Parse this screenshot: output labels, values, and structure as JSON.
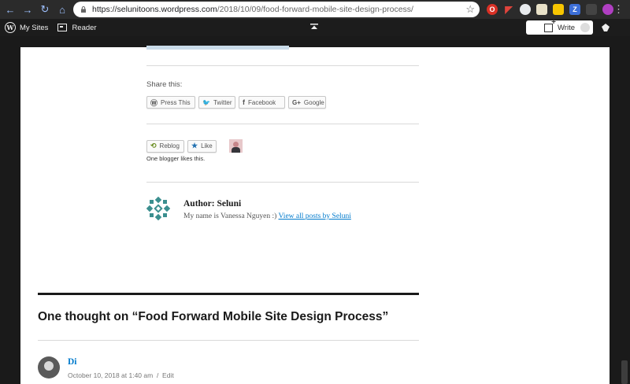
{
  "browser": {
    "url_host": "https://selunitoons.wordpress.com",
    "url_path": "/2018/10/09/food-forward-mobile-site-design-process/",
    "extension_label_z": "Z"
  },
  "admin_bar": {
    "my_sites_label": "My Sites",
    "reader_label": "Reader",
    "write_label": "Write"
  },
  "post": {
    "share_title": "Share this:",
    "share_buttons": [
      {
        "icon": "press-this-icon",
        "glyph": "Ⓦ",
        "label": "Press This"
      },
      {
        "icon": "twitter-icon",
        "glyph": "🐦",
        "label": "Twitter"
      },
      {
        "icon": "facebook-icon",
        "glyph": "f",
        "label": "Facebook"
      },
      {
        "icon": "google-icon",
        "glyph": "G+",
        "label": "Google"
      }
    ],
    "reblog_label": "Reblog",
    "like_label": "Like",
    "likes_text": "One blogger likes this.",
    "author_heading": "Author: Seluni",
    "author_bio": "My name is Vanessa Nguyen :)",
    "author_link": "View all posts by Seluni"
  },
  "comments": {
    "title": "One thought on “Food Forward Mobile Site Design Process”",
    "items": [
      {
        "name": "Di",
        "date": "October 10, 2018 at 1:40 am",
        "edit": "Edit"
      }
    ]
  },
  "colors": {
    "link": "#007acc",
    "admin_bar": "#1c1c1c",
    "chrome": "#2b2b2b"
  }
}
